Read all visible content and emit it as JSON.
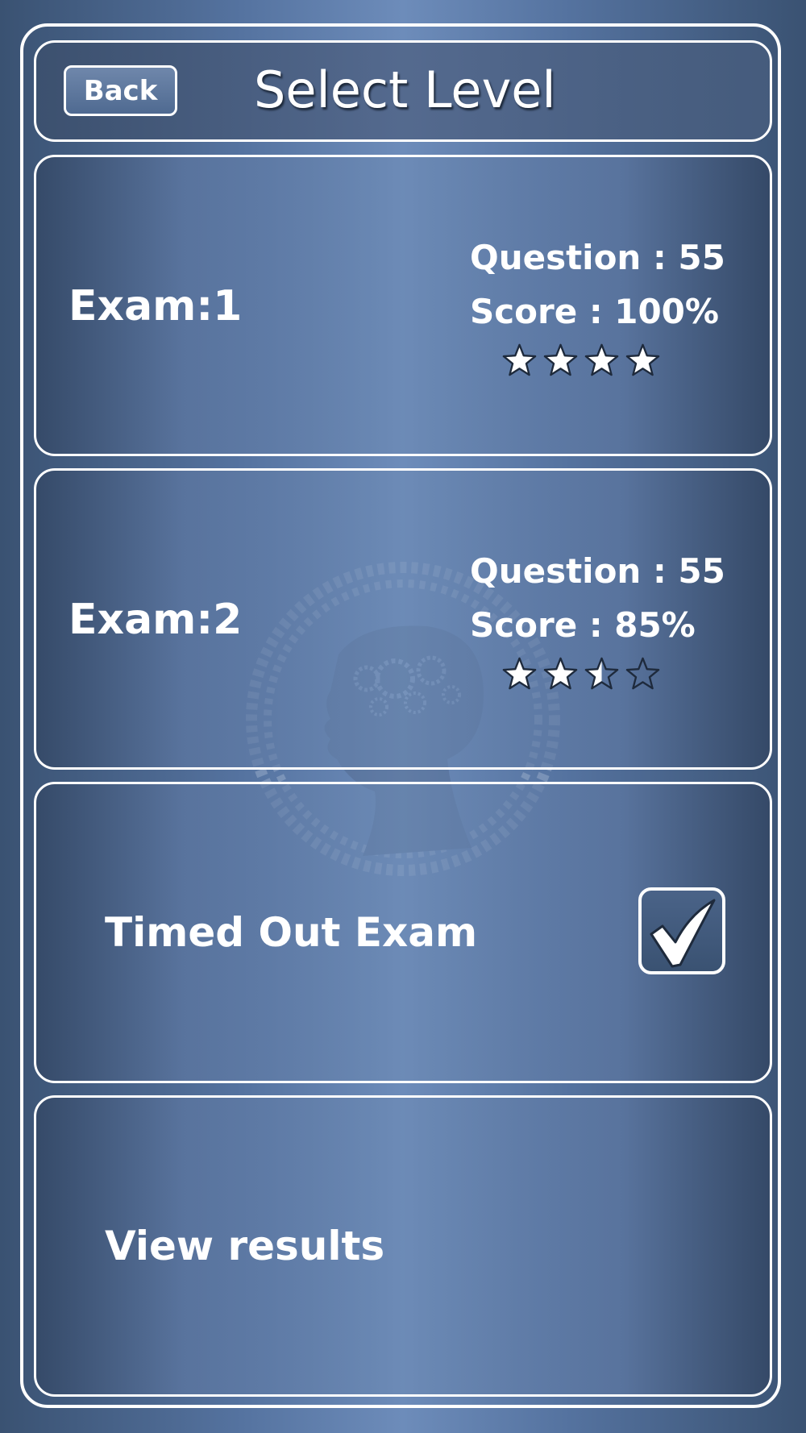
{
  "header": {
    "back_label": "Back",
    "title": "Select Level"
  },
  "exams": [
    {
      "label": "Exam:1",
      "question": "Question : 55",
      "score": "Score : 100%",
      "stars_rating": 4,
      "stars_max": 4
    },
    {
      "label": "Exam:2",
      "question": "Question : 55",
      "score": "Score : 85%",
      "stars_rating": 2.5,
      "stars_max": 4
    }
  ],
  "timed_out": {
    "label": "Timed Out Exam",
    "checked": true
  },
  "results": {
    "label": "View results"
  },
  "icons": {
    "watermark": "brain-gears-head-icon",
    "star": "star-icon",
    "checkmark": "checkmark-icon"
  },
  "colors": {
    "star_fill": "#ffffff",
    "star_stroke": "#1e2a3c",
    "border": "#ffffff"
  }
}
